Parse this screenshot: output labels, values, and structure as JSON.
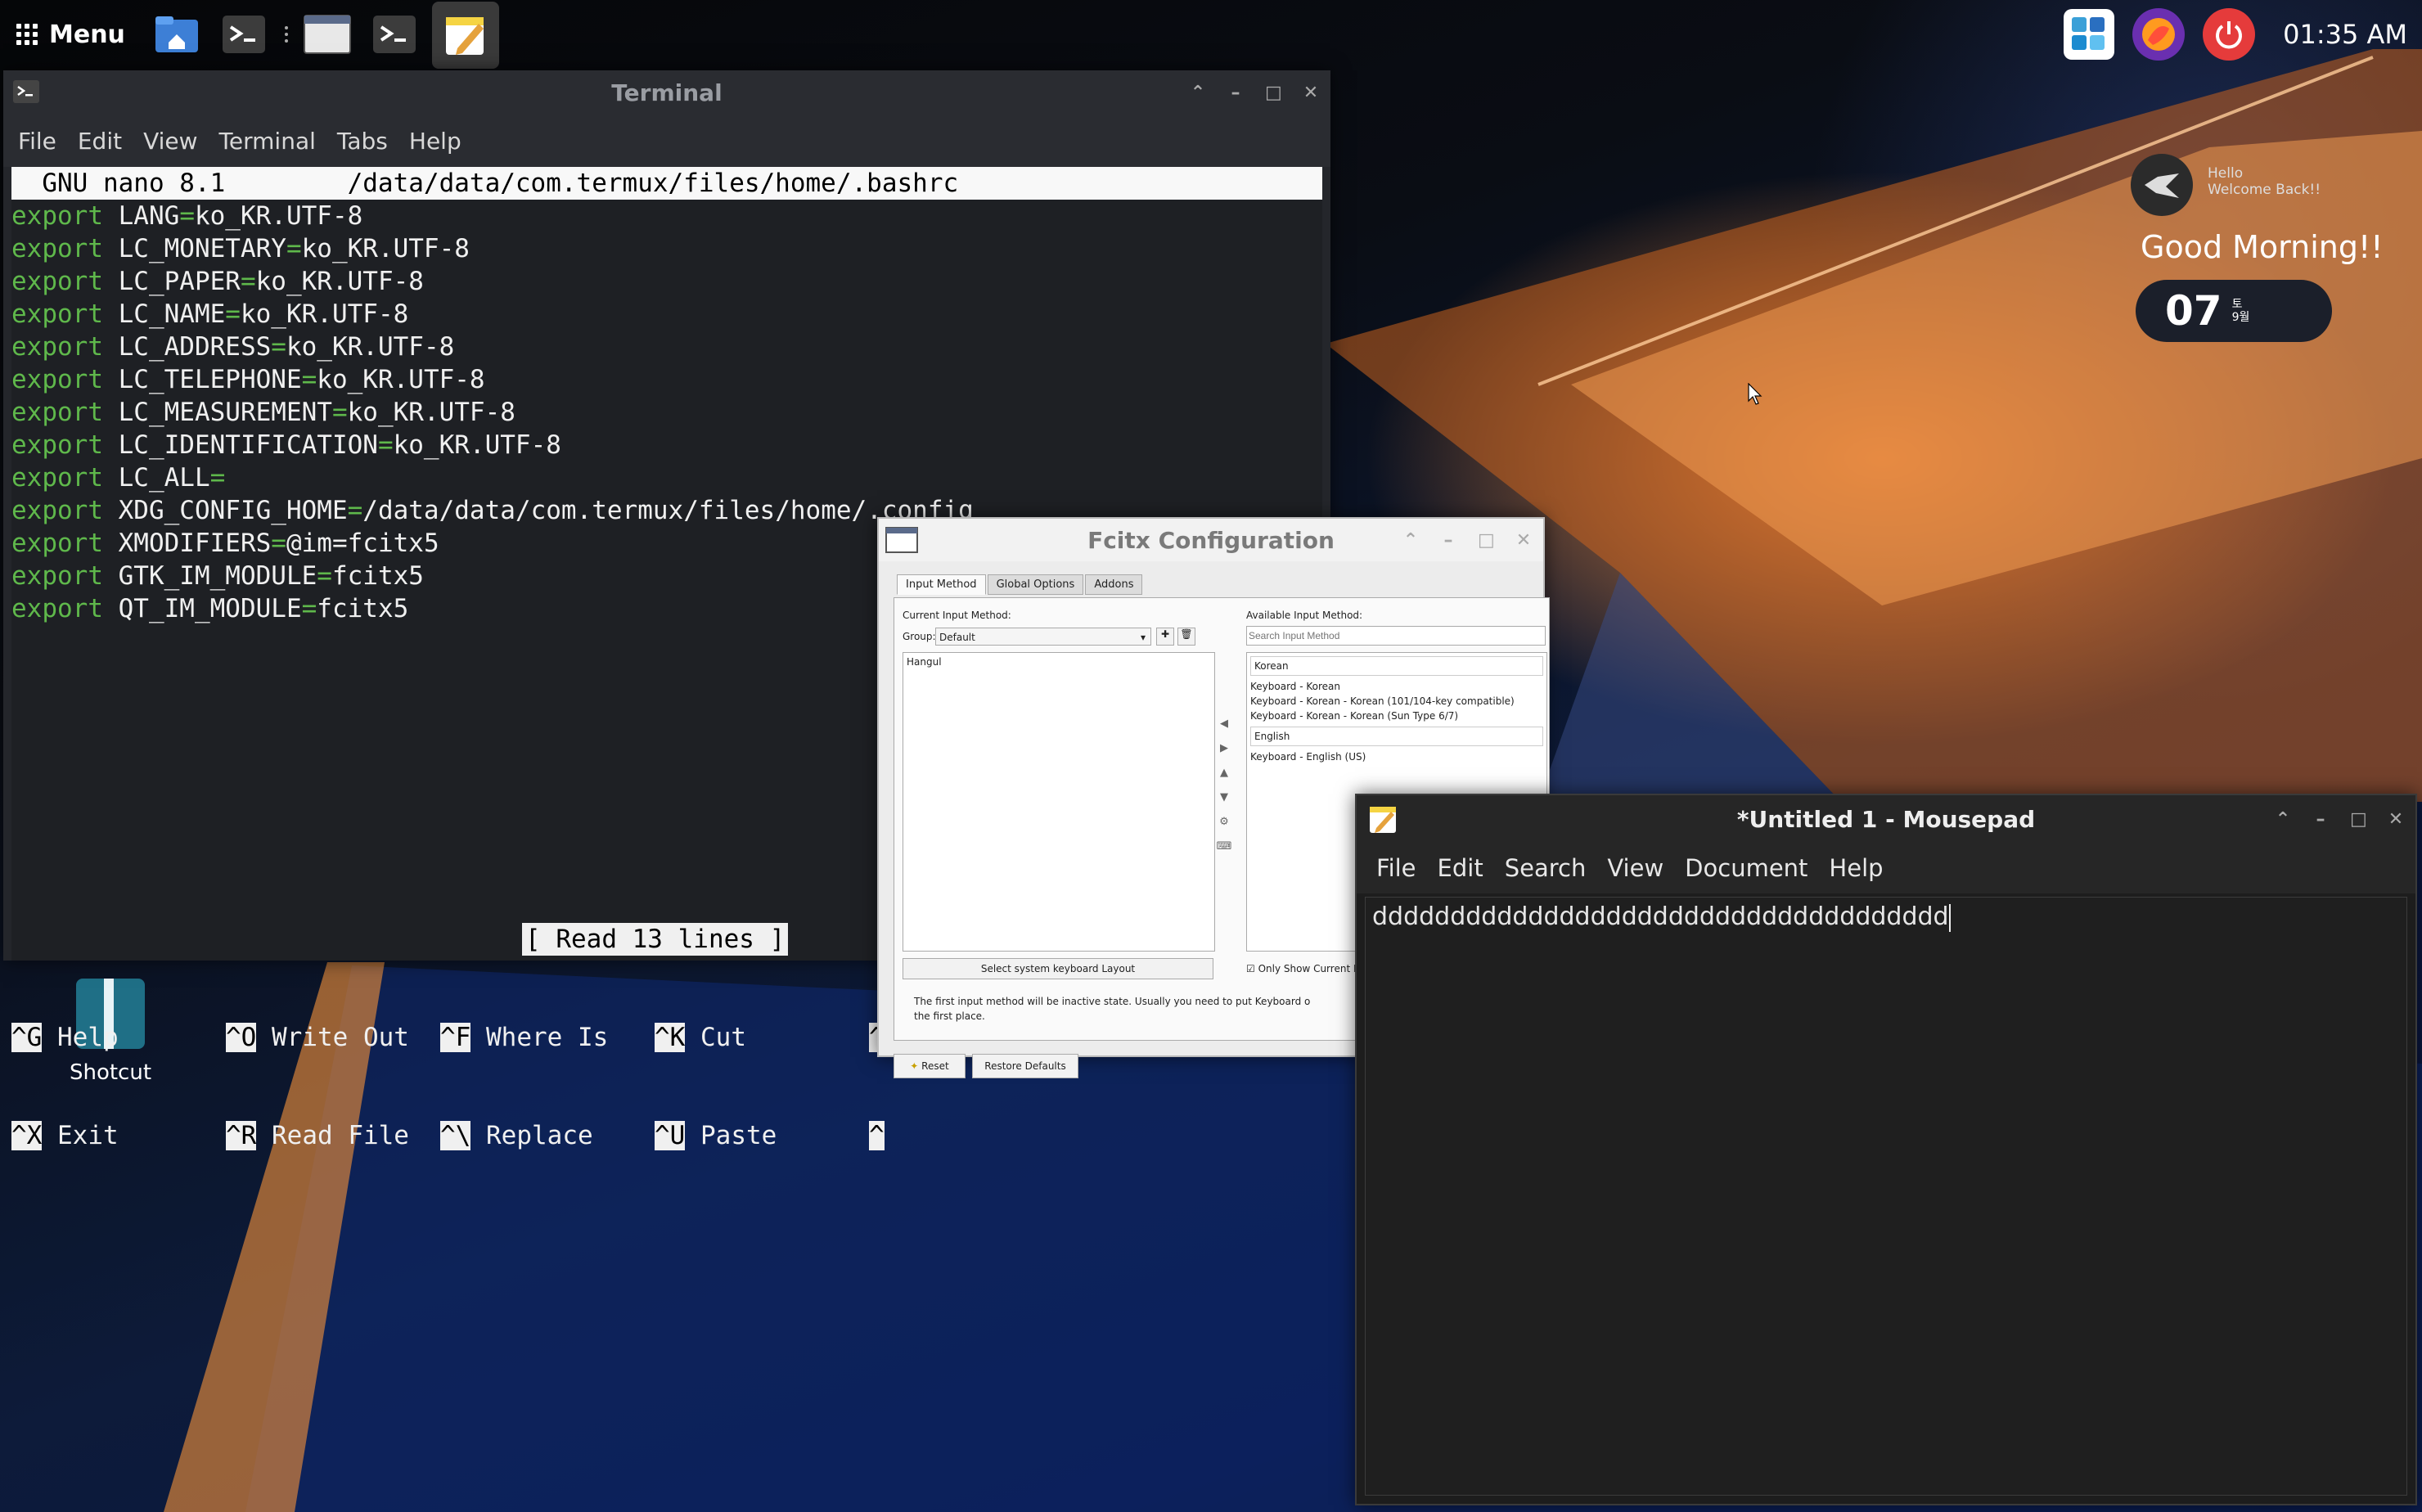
{
  "panel": {
    "menu_label": "Menu",
    "clock": "01:35 AM",
    "launchers": [
      "file-manager-icon",
      "terminal-icon",
      "window-icon",
      "terminal-icon",
      "text-editor-icon"
    ],
    "tray": [
      "app-store-icon",
      "firefox-icon",
      "power-icon"
    ]
  },
  "widget": {
    "hello": "Hello",
    "welcome": "Welcome Back!!",
    "greeting": "Good Morning!!",
    "day": "07",
    "weekday": "토",
    "month": "9월"
  },
  "desktop": {
    "icons": [
      {
        "label": "Shotcut"
      }
    ]
  },
  "terminal": {
    "title": "Terminal",
    "menu": [
      "File",
      "Edit",
      "View",
      "Terminal",
      "Tabs",
      "Help"
    ],
    "nano_header": "  GNU nano 8.1        /data/data/com.termux/files/home/.bashrc",
    "lines": [
      {
        "kw": "export",
        "name": " LANG",
        "val": "ko_KR.UTF-8"
      },
      {
        "kw": "export",
        "name": " LC_MONETARY",
        "val": "ko_KR.UTF-8"
      },
      {
        "kw": "export",
        "name": " LC_PAPER",
        "val": "ko_KR.UTF-8"
      },
      {
        "kw": "export",
        "name": " LC_NAME",
        "val": "ko_KR.UTF-8"
      },
      {
        "kw": "export",
        "name": " LC_ADDRESS",
        "val": "ko_KR.UTF-8"
      },
      {
        "kw": "export",
        "name": " LC_TELEPHONE",
        "val": "ko_KR.UTF-8"
      },
      {
        "kw": "export",
        "name": " LC_MEASUREMENT",
        "val": "ko_KR.UTF-8"
      },
      {
        "kw": "export",
        "name": " LC_IDENTIFICATION",
        "val": "ko_KR.UTF-8"
      },
      {
        "kw": "export",
        "name": " LC_ALL",
        "val": ""
      },
      {
        "kw": "export",
        "name": " XDG_CONFIG_HOME",
        "val": "/data/data/com.termux/files/home/.config"
      },
      {
        "kw": "export",
        "name": " XMODIFIERS",
        "val": "@im=fcitx5"
      },
      {
        "kw": "export",
        "name": " GTK_IM_MODULE",
        "val": "fcitx5"
      },
      {
        "kw": "export",
        "name": " QT_IM_MODULE",
        "val": "fcitx5"
      }
    ],
    "status": "[ Read 13 lines ]",
    "shortcuts_row1": [
      {
        "key": "^G",
        "label": "Help"
      },
      {
        "key": "^O",
        "label": "Write Out"
      },
      {
        "key": "^F",
        "label": "Where Is"
      },
      {
        "key": "^K",
        "label": "Cut"
      },
      {
        "key": "^",
        "label": ""
      }
    ],
    "shortcuts_row2": [
      {
        "key": "^X",
        "label": "Exit"
      },
      {
        "key": "^R",
        "label": "Read File"
      },
      {
        "key": "^\\",
        "label": "Replace"
      },
      {
        "key": "^U",
        "label": "Paste"
      },
      {
        "key": "^",
        "label": ""
      }
    ]
  },
  "fcitx": {
    "title": "Fcitx Configuration",
    "tabs": [
      "Input Method",
      "Global Options",
      "Addons"
    ],
    "current_label": "Current Input Method:",
    "group_label": "Group:",
    "group_value": "Default",
    "current_items": [
      "Hangul"
    ],
    "available_label": "Available Input Method:",
    "search_placeholder": "Search Input Method",
    "avail_groups": [
      {
        "name": "Korean",
        "items": [
          "Keyboard - Korean",
          "Keyboard - Korean - Korean (101/104-key compatible)",
          "Keyboard - Korean - Korean (Sun Type 6/7)"
        ]
      },
      {
        "name": "English",
        "items": [
          "Keyboard - English (US)"
        ]
      }
    ],
    "select_layout": "Select system keyboard Layout",
    "only_show": "Only Show Current Lang",
    "hint": "The first input method will be inactive state. Usually you need to put Keyboard o",
    "hint2": "the first place.",
    "reset": "Reset",
    "restore": "Restore Defaults"
  },
  "mousepad": {
    "title": "*Untitled 1 - Mousepad",
    "menu": [
      "File",
      "Edit",
      "Search",
      "View",
      "Document",
      "Help"
    ],
    "content": "ddddddddddddddddddddddddddddddddddddd"
  }
}
